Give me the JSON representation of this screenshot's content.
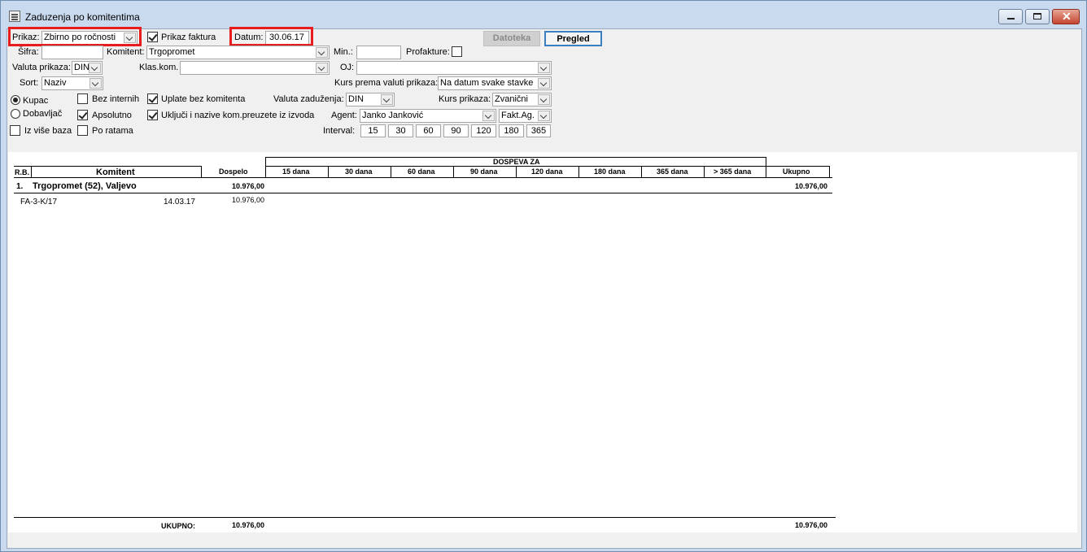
{
  "window": {
    "title": "Zaduzenja po komitentima"
  },
  "form": {
    "prikaz_label": "Prikaz:",
    "prikaz_value": "Zbirno po ročnosti",
    "prikaz_faktura_label": "Prikaz faktura",
    "datum_label": "Datum:",
    "datum_value": "30.06.17",
    "datoteka_btn": "Datoteka",
    "pregled_btn": "Pregled",
    "sifra_label": "Šifra:",
    "sifra_value": "",
    "komitent_label": "Komitent:",
    "komitent_value": "Trgopromet",
    "min_label": "Min.:",
    "min_value": "",
    "profakture_label": "Profakture:",
    "valuta_prikaza_label": "Valuta prikaza:",
    "valuta_prikaza_value": "DIN",
    "klas_kom_label": "Klas.kom.",
    "klas_kom_value": "",
    "oj_label": "OJ:",
    "oj_value": "",
    "sort_label": "Sort:",
    "sort_value": "Naziv",
    "kurs_prema_label": "Kurs prema valuti prikaza:",
    "kurs_prema_value": "Na datum svake stavke",
    "kupac_label": "Kupac",
    "dobavljac_label": "Dobavljač",
    "bez_internih_label": "Bez internih",
    "apsolutno_label": "Apsolutno",
    "uplate_bez_label": "Uplate bez komitenta",
    "ukljuci_label": "Uključi i nazive kom.preuzete iz izvoda",
    "valuta_zaduzenja_label": "Valuta zaduženja:",
    "valuta_zaduzenja_value": "DIN",
    "kurs_prikaza_label": "Kurs prikaza:",
    "kurs_prikaza_value": "Zvanični",
    "agent_label": "Agent:",
    "agent_value": "Janko Janković",
    "fakt_ag_value": "Fakt.Ag.",
    "iz_vise_baza_label": "Iz više baza",
    "po_ratama_label": "Po ratama",
    "interval_label": "Interval:",
    "intervals": [
      "15",
      "30",
      "60",
      "90",
      "120",
      "180",
      "365"
    ]
  },
  "report": {
    "dospeva_za": "DOSPEVA ZA",
    "headers": {
      "rb": "R.B.",
      "komitent": "Komitent",
      "dospelo": "Dospelo",
      "d15": "15 dana",
      "d30": "30 dana",
      "d60": "60 dana",
      "d90": "90 dana",
      "d120": "120 dana",
      "d180": "180 dana",
      "d365": "365 dana",
      "dmore": "> 365 dana",
      "ukupno": "Ukupno"
    },
    "group": {
      "num": "1.",
      "name": "Trgopromet (52), Valjevo",
      "dospelo": "10.976,00",
      "ukupno": "10.976,00"
    },
    "item": {
      "doc": "FA-3-K/17",
      "date": "14.03.17",
      "dospelo": "10.976,00"
    },
    "total": {
      "label": "UKUPNO:",
      "dospelo": "10.976,00",
      "ukupno": "10.976,00"
    }
  }
}
